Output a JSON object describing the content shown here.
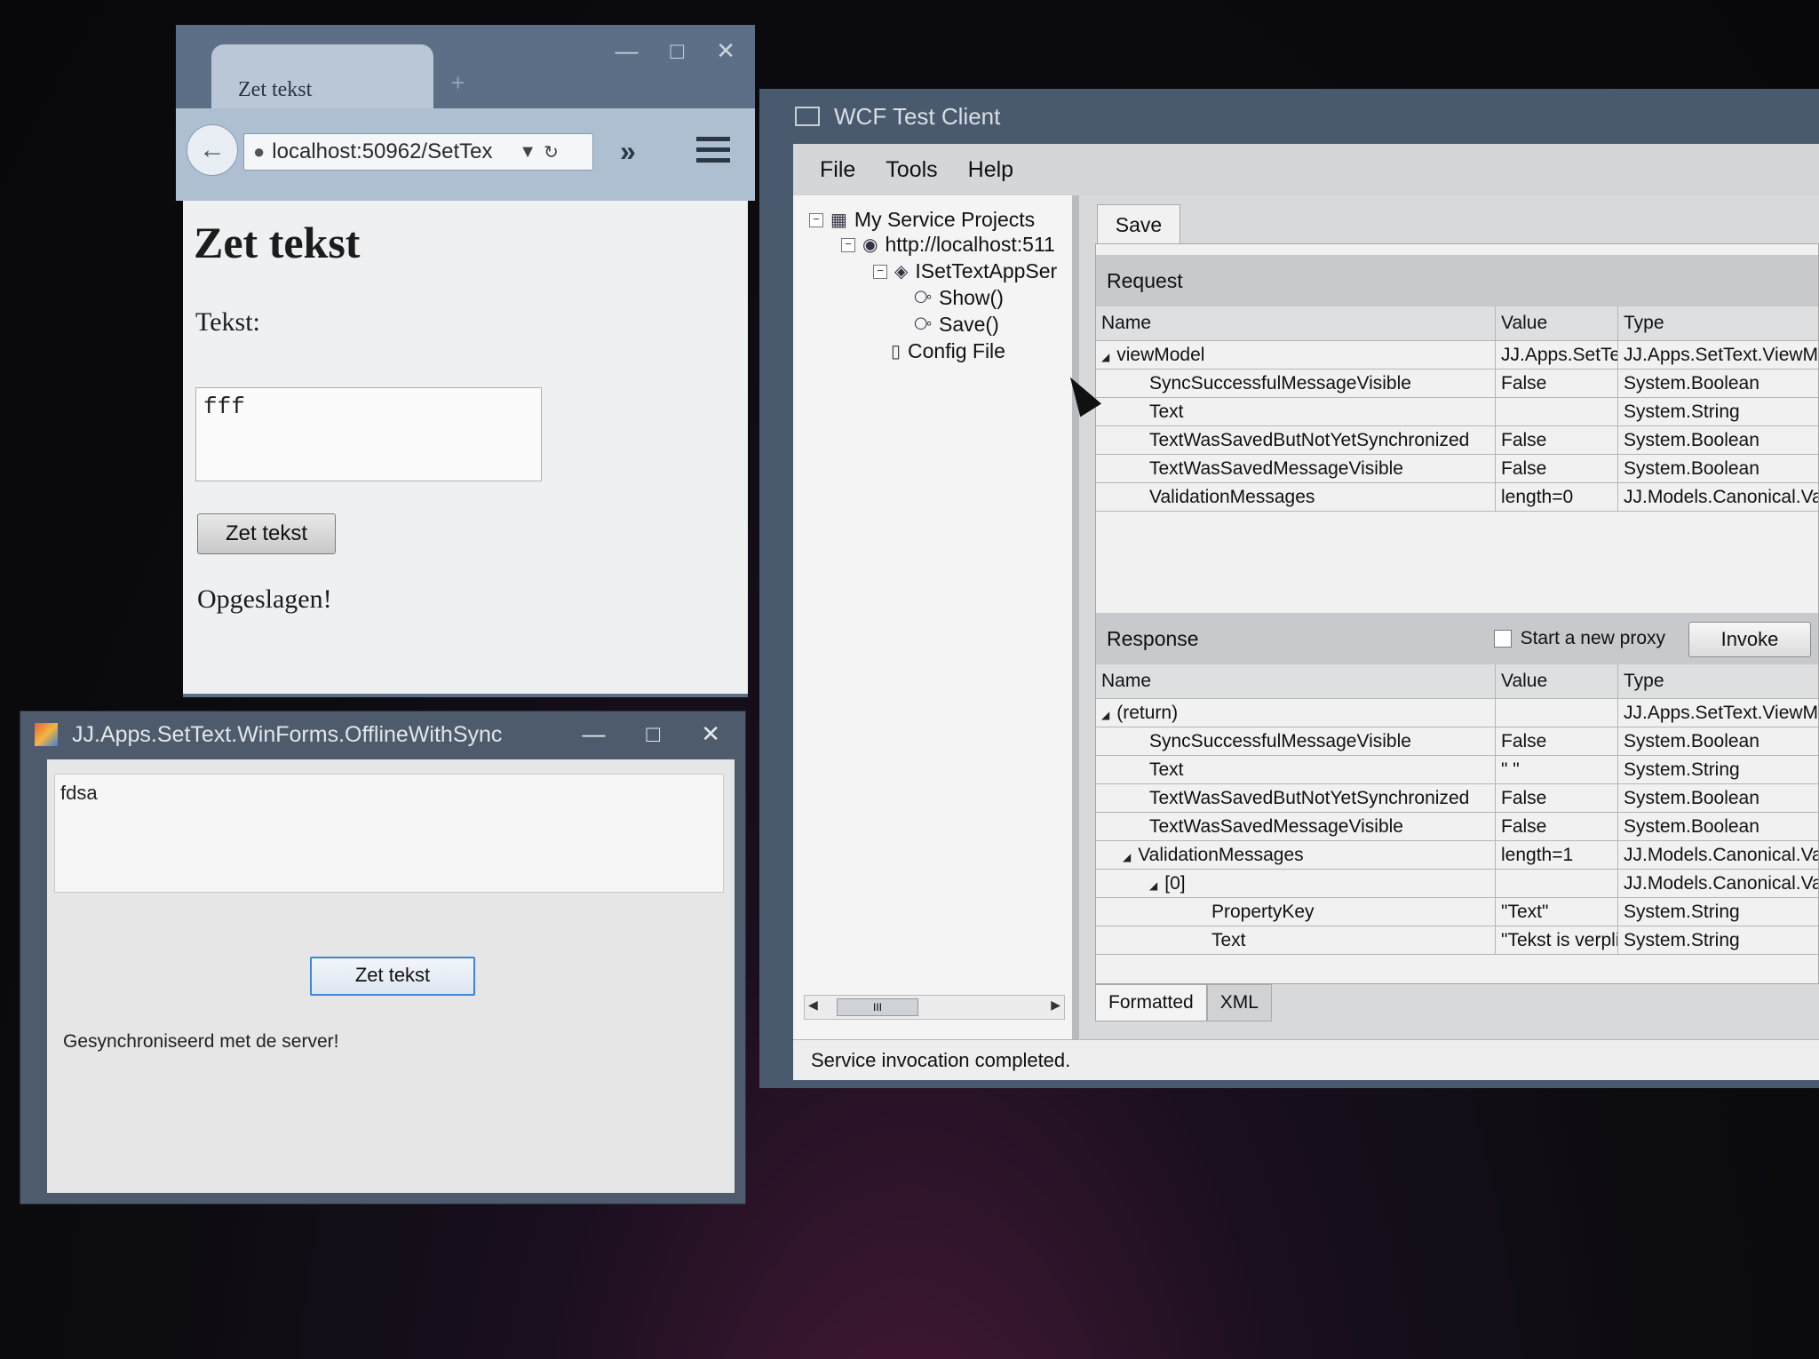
{
  "browser": {
    "tab_title": "Zet tekst",
    "new_tab": "+",
    "url": "localhost:50962/SetTex",
    "page": {
      "heading": "Zet tekst",
      "label": "Tekst:",
      "textarea_value": "fff",
      "button": "Zet tekst",
      "message": "Opgeslagen!"
    }
  },
  "winforms": {
    "title": "JJ.Apps.SetText.WinForms.OfflineWithSync",
    "textbox_value": "fdsa",
    "button": "Zet tekst",
    "status": "Gesynchroniseerd met de server!"
  },
  "wcf": {
    "title": "WCF Test Client",
    "menu": [
      "File",
      "Tools",
      "Help"
    ],
    "tree": {
      "root": "My Service Projects",
      "endpoint": "http://localhost:511",
      "contract": "ISetTextAppSer",
      "op1": "Show()",
      "op2": "Save()",
      "config": "Config File"
    },
    "active_tab": "Save",
    "request_label": "Request",
    "response_label": "Response",
    "columns": {
      "name": "Name",
      "value": "Value",
      "type": "Type"
    },
    "request_rows": [
      {
        "name": "viewModel",
        "value": "JJ.Apps.SetTe",
        "type": "JJ.Apps.SetText.ViewModel"
      },
      {
        "name": "SyncSuccessfulMessageVisible",
        "value": "False",
        "type": "System.Boolean"
      },
      {
        "name": "Text",
        "value": "",
        "type": "System.String"
      },
      {
        "name": "TextWasSavedButNotYetSynchronized",
        "value": "False",
        "type": "System.Boolean"
      },
      {
        "name": "TextWasSavedMessageVisible",
        "value": "False",
        "type": "System.Boolean"
      },
      {
        "name": "ValidationMessages",
        "value": "length=0",
        "type": "JJ.Models.Canonical.Validatio"
      }
    ],
    "start_new_proxy": "Start a new proxy",
    "invoke": "Invoke",
    "response_rows": [
      {
        "name": "(return)",
        "value": "",
        "type": "JJ.Apps.SetText.ViewMo"
      },
      {
        "name": "SyncSuccessfulMessageVisible",
        "value": "False",
        "type": "System.Boolean"
      },
      {
        "name": "Text",
        "value": "\" \"",
        "type": "System.String"
      },
      {
        "name": "TextWasSavedButNotYetSynchronized",
        "value": "False",
        "type": "System.Boolean"
      },
      {
        "name": "TextWasSavedMessageVisible",
        "value": "False",
        "type": "System.Boolean"
      },
      {
        "name": "ValidationMessages",
        "value": "length=1",
        "type": "JJ.Models.Canonical.Valic"
      },
      {
        "name": "[0]",
        "value": "",
        "type": "JJ.Models.Canonical.Valic"
      },
      {
        "name": "PropertyKey",
        "value": "\"Text\"",
        "type": "System.String"
      },
      {
        "name": "Text",
        "value": "\"Tekst is verplicht.\"",
        "type": "System.String"
      }
    ],
    "bottom_tabs": [
      "Formatted",
      "XML"
    ],
    "scroll_thumb": "III",
    "status": "Service invocation completed."
  }
}
